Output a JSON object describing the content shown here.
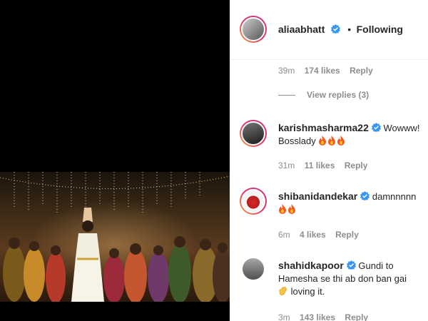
{
  "post": {
    "author": "aliaabhatt",
    "follow_dot": "•",
    "follow_status": "Following"
  },
  "reply_meta": {
    "time": "39m",
    "likes": "174 likes",
    "reply": "Reply"
  },
  "view_replies": "View replies (3)",
  "comments": [
    {
      "user": "karishmasharma22",
      "text_line1": "Wowww!",
      "text_line2": "Bosslady",
      "emoji": [
        "fire",
        "fire",
        "fire"
      ],
      "time": "31m",
      "likes": "11 likes",
      "reply": "Reply"
    },
    {
      "user": "shibanidandekar",
      "text_line1": "damnnnnn",
      "emoji": [
        "fire",
        "fire"
      ],
      "time": "6m",
      "likes": "4 likes",
      "reply": "Reply"
    },
    {
      "user": "shahidkapoor",
      "text_line1": "Gundi to",
      "text_line2": "Hamesha se thi ab don ban gai",
      "text_line3": "loving it.",
      "emoji": [
        "clapping-hands"
      ],
      "time": "3m",
      "likes": "143 likes",
      "reply": "Reply"
    }
  ],
  "colors": {
    "verified_blue": "#3897f0",
    "meta_gray": "#8e8e8e",
    "text_dark": "#262626",
    "story_ring_start": "#f9a03c",
    "story_ring_end": "#c13584"
  }
}
